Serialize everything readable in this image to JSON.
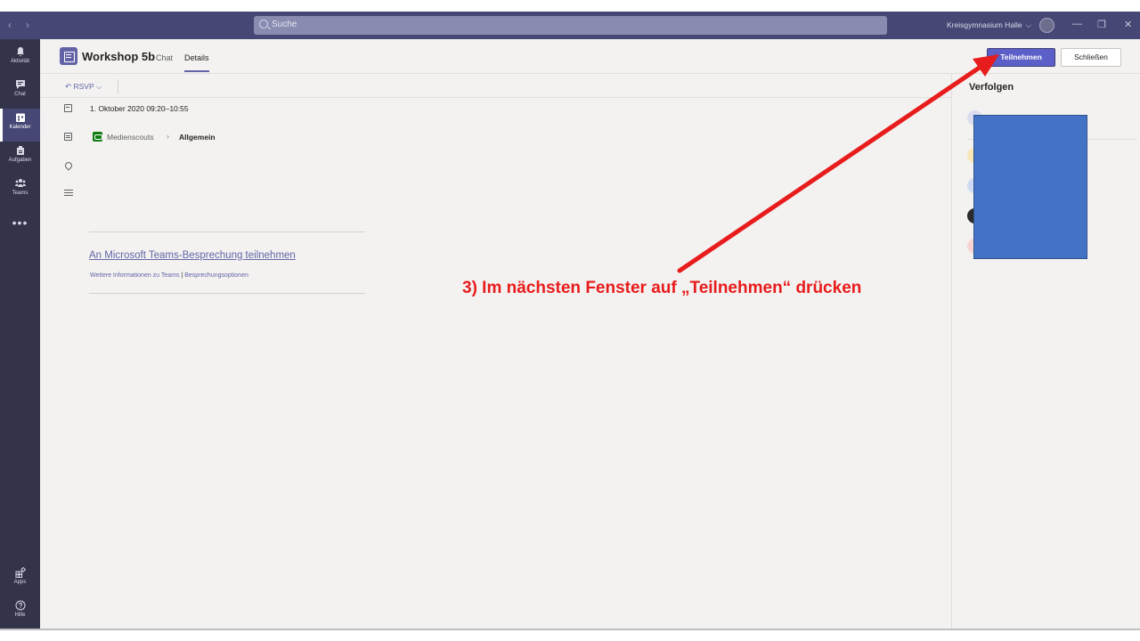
{
  "titlebar": {
    "search_placeholder": "Suche",
    "org_name": "Kreisgymnasium Halle",
    "org_chevron": "⌵",
    "back_arrow": "‹",
    "forward_arrow": "›",
    "minimize": "—",
    "maximize": "❐",
    "close": "✕"
  },
  "rail": {
    "items": [
      {
        "label": "Aktivität",
        "icon": "bell-icon"
      },
      {
        "label": "Chat",
        "icon": "chat-icon"
      },
      {
        "label": "Kalender",
        "icon": "calendar-icon",
        "active": true
      },
      {
        "label": "Aufgaben",
        "icon": "assignments-icon"
      },
      {
        "label": "Teams",
        "icon": "teams-icon"
      }
    ],
    "more": "•••",
    "bottom": [
      {
        "label": "Apps",
        "icon": "apps-icon"
      },
      {
        "label": "Hilfe",
        "icon": "help-icon"
      }
    ]
  },
  "header": {
    "title": "Workshop 5b",
    "tab_chat": "Chat",
    "tab_details": "Details",
    "join_label": "Teilnehmen",
    "close_label": "Schließen"
  },
  "rsvp": {
    "label": "↶ RSVP ⌵"
  },
  "details": {
    "datetime": "1. Oktober 2020 09:20–10:55",
    "team": "Medienscouts",
    "separator": "›",
    "channel": "Allgemein",
    "join_link": "An Microsoft Teams-Besprechung teilnehmen",
    "more_info": "Weitere Informationen zu Teams",
    "link_separator": "|",
    "meeting_options": "Besprechungsoptionen"
  },
  "right_panel": {
    "title": "Verfolgen"
  },
  "annotation": {
    "text": "3) Im nächsten Fenster auf „Teilnehmen“ drücken",
    "color": "#e81c1c"
  },
  "colors": {
    "brand": "#6264a7",
    "titlebar": "#464775",
    "rail": "#33344a"
  }
}
